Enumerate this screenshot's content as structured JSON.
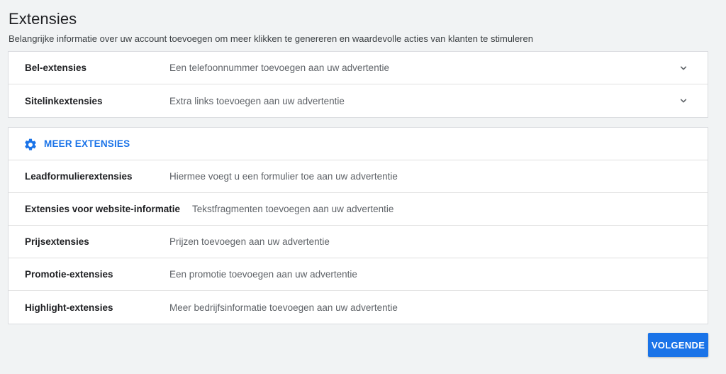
{
  "header": {
    "title": "Extensies",
    "subtitle": "Belangrijke informatie over uw account toevoegen om meer klikken te genereren en waardevolle acties van klanten te stimuleren"
  },
  "expandable": [
    {
      "name": "Bel-extensies",
      "description": "Een telefoonnummer toevoegen aan uw advertentie",
      "icon": "chevron-down-icon"
    },
    {
      "name": "Sitelinkextensies",
      "description": "Extra links toevoegen aan uw advertentie",
      "icon": "chevron-down-icon"
    }
  ],
  "more": {
    "label": "MEER EXTENSIES",
    "icon": "gear-icon",
    "items": [
      {
        "name": "Leadformulierextensies",
        "description": "Hiermee voegt u een formulier toe aan uw advertentie"
      },
      {
        "name": "Extensies voor website-informatie",
        "description": "Tekstfragmenten toevoegen aan uw advertentie"
      },
      {
        "name": "Prijsextensies",
        "description": "Prijzen toevoegen aan uw advertentie"
      },
      {
        "name": "Promotie-extensies",
        "description": "Een promotie toevoegen aan uw advertentie"
      },
      {
        "name": "Highlight-extensies",
        "description": "Meer bedrijfsinformatie toevoegen aan uw advertentie"
      }
    ]
  },
  "footer": {
    "next_label": "VOLGENDE"
  },
  "colors": {
    "accent": "#1a73e8",
    "background": "#f1f3f4"
  }
}
